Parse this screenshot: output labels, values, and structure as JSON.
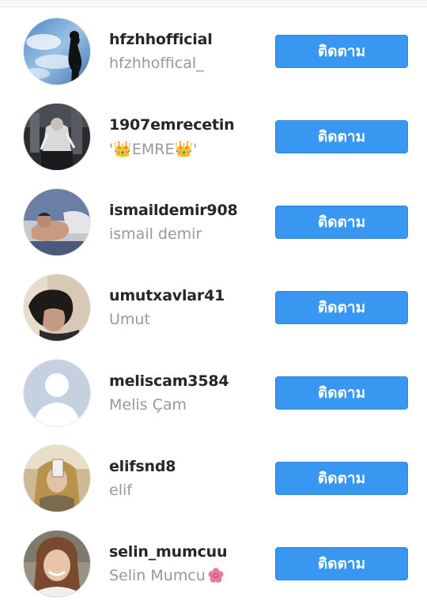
{
  "follow_label": "ติดตาม",
  "accent_color": "#3897f0",
  "users": [
    {
      "username": "hfzhhofficial",
      "full_name": "hfzhhoffical_",
      "avatar": "sky-silhouette-photo"
    },
    {
      "username": "1907emrecetin",
      "full_name": "'👑EMRE👑'",
      "avatar": "dark-stage-photo"
    },
    {
      "username": "ismaildemir908",
      "full_name": "ismail demir",
      "avatar": "reclining-man-photo"
    },
    {
      "username": "umutxavlar41",
      "full_name": "Umut",
      "avatar": "boy-portrait-photo"
    },
    {
      "username": "meliscam3584",
      "full_name": "Melis Çam",
      "avatar": "default-profile-placeholder"
    },
    {
      "username": "elifsnd8",
      "full_name": "elif",
      "avatar": "girl-selfie-photo"
    },
    {
      "username": "selin_mumcuu",
      "full_name": "Selin Mumcu",
      "avatar": "smiling-woman-photo",
      "suffix_icon": "pink-flower-icon"
    }
  ]
}
